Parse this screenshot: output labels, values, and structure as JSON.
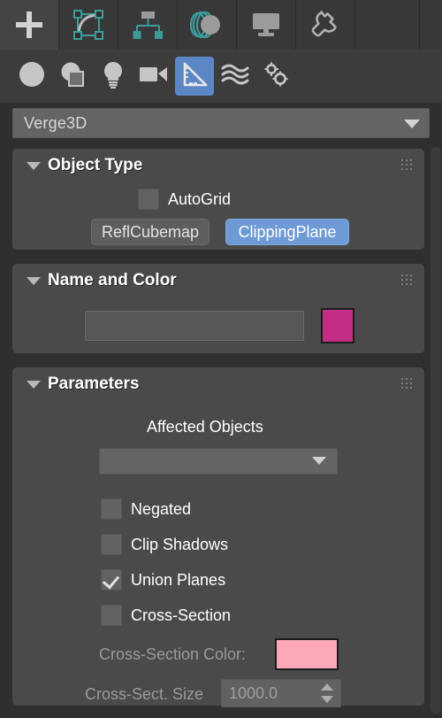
{
  "panel": {
    "category_combo": {
      "value": "Verge3D",
      "icon": "chevron-down-icon"
    }
  },
  "command_tabs": [
    {
      "name": "create",
      "icon": "plus-icon",
      "active": true
    },
    {
      "name": "modify",
      "icon": "modify-curve-icon",
      "active": false
    },
    {
      "name": "hierarchy",
      "icon": "hierarchy-icon",
      "active": false
    },
    {
      "name": "motion",
      "icon": "motion-circles-icon",
      "active": false
    },
    {
      "name": "display",
      "icon": "display-monitor-icon",
      "active": false
    },
    {
      "name": "utilities",
      "icon": "wrench-icon",
      "active": false
    }
  ],
  "object_categories": [
    {
      "name": "geometry",
      "icon": "sphere-icon",
      "active": false
    },
    {
      "name": "shapes",
      "icon": "shapes-icon",
      "active": false
    },
    {
      "name": "lights",
      "icon": "lightbulb-icon",
      "active": false
    },
    {
      "name": "cameras",
      "icon": "camera-icon",
      "active": false
    },
    {
      "name": "helpers",
      "icon": "triangle-ruler-icon",
      "active": true
    },
    {
      "name": "space-warps",
      "icon": "waves-icon",
      "active": false
    },
    {
      "name": "systems",
      "icon": "gears-icon",
      "active": false
    }
  ],
  "object_type": {
    "title": "Object Type",
    "autogrid": {
      "label": "AutoGrid",
      "checked": false
    },
    "buttons": [
      {
        "label": "ReflCubemap",
        "selected": false
      },
      {
        "label": "ClippingPlane",
        "selected": true
      }
    ]
  },
  "name_and_color": {
    "title": "Name and Color",
    "name_value": "",
    "name_placeholder": "",
    "color": "#C22E85"
  },
  "parameters": {
    "title": "Parameters",
    "affected_objects_label": "Affected Objects",
    "affected_objects_value": "",
    "checkboxes": [
      {
        "label": "Negated",
        "checked": false
      },
      {
        "label": "Clip Shadows",
        "checked": false
      },
      {
        "label": "Union Planes",
        "checked": true
      },
      {
        "label": "Cross-Section",
        "checked": false
      }
    ],
    "cross_section_color_label": "Cross-Section Color:",
    "cross_section_color": "#FDA8B7",
    "cross_section_size_label": "Cross-Sect. Size",
    "cross_section_size_value": "1000.0"
  },
  "colors": {
    "accent_blue": "#6e9bd6",
    "panel_bg": "#4a4a4a",
    "window_bg": "#2f2f2f",
    "teal_icon": "#3e9b9b"
  }
}
